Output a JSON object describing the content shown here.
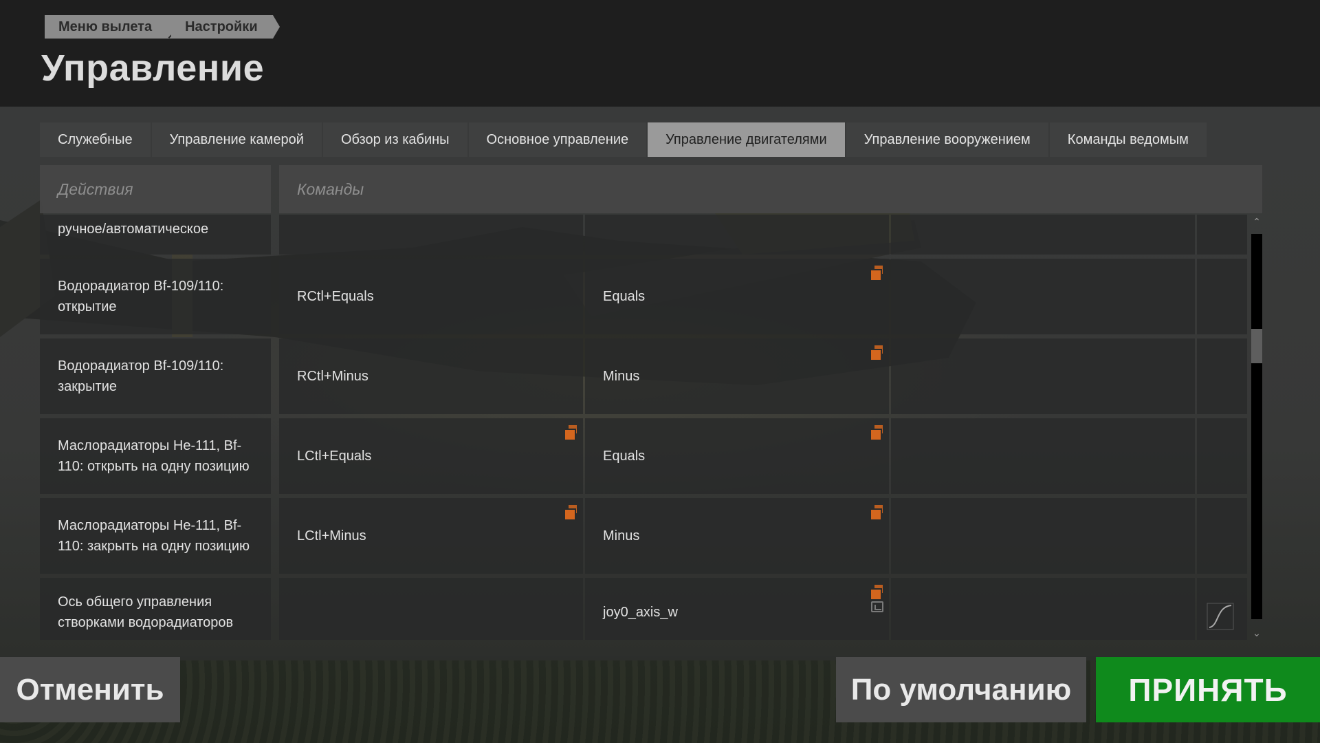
{
  "header": {
    "breadcrumb": [
      "Меню вылета",
      "Настройки"
    ],
    "title": "Управление"
  },
  "tabs": [
    {
      "label": "Служебные",
      "active": false
    },
    {
      "label": "Управление камерой",
      "active": false
    },
    {
      "label": "Обзор из кабины",
      "active": false
    },
    {
      "label": "Основное управление",
      "active": false
    },
    {
      "label": "Управление двигателями",
      "active": true
    },
    {
      "label": "Управление вооружением",
      "active": false
    },
    {
      "label": "Команды ведомым",
      "active": false
    }
  ],
  "table": {
    "headers": {
      "actions": "Действия",
      "commands": "Команды"
    },
    "rows": [
      {
        "action": "ручное/автоматическое",
        "cmd1": "",
        "cmd2": "",
        "cmd3": ""
      },
      {
        "action": "Водорадиатор Bf-109/110: открытие",
        "cmd1": "RCtl+Equals",
        "cmd2": "Equals",
        "cmd3": ""
      },
      {
        "action": "Водорадиатор Bf-109/110: закрытие",
        "cmd1": "RCtl+Minus",
        "cmd2": "Minus",
        "cmd3": ""
      },
      {
        "action": "Маслорадиаторы He-111, Bf-110: открыть на одну позицию",
        "cmd1": "LCtl+Equals",
        "cmd2": "Equals",
        "cmd3": ""
      },
      {
        "action": "Маслорадиаторы He-111, Bf-110: закрыть на одну позицию",
        "cmd1": "LCtl+Minus",
        "cmd2": "Minus",
        "cmd3": ""
      },
      {
        "action": "Ось общего управления створками водорадиаторов",
        "cmd1": "",
        "cmd2": "joy0_axis_w",
        "cmd3": ""
      }
    ]
  },
  "scrollbar": {
    "position_fraction": 0.27
  },
  "buttons": {
    "cancel": "Отменить",
    "default": "По умолчанию",
    "accept": "ПРИНЯТЬ"
  },
  "colors": {
    "accent_orange": "#d4661e",
    "accept_green": "#0f8a1c",
    "active_tab": "#9a9a9a"
  },
  "icons": [
    "copy-binding-icon",
    "invert-axis-icon",
    "axis-curve-icon",
    "chevron-up-icon",
    "chevron-down-icon"
  ]
}
